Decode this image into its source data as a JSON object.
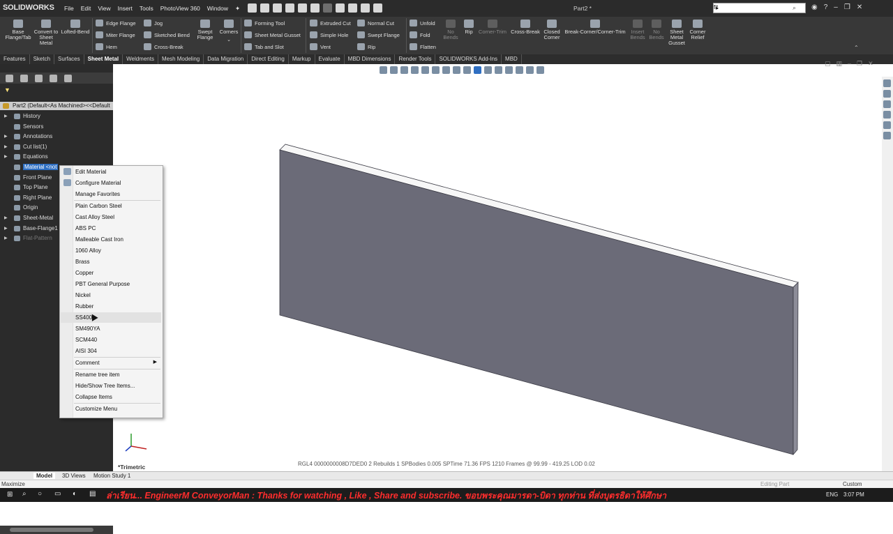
{
  "app": {
    "logo": "SOLIDWORKS",
    "menu": [
      "File",
      "Edit",
      "View",
      "Insert",
      "Tools",
      "PhotoView 360",
      "Window"
    ],
    "doc_title": "Part2 *",
    "search_value": "fit"
  },
  "ribbon": {
    "big_left": [
      {
        "label": "Base Flange/Tab",
        "icon": "base-flange-icon"
      },
      {
        "label": "Convert to Sheet Metal",
        "icon": "convert-icon"
      },
      {
        "label": "Lofted-Bend",
        "icon": "lofted-bend-icon"
      }
    ],
    "col1": [
      "Edge Flange",
      "Miter Flange",
      "Hem"
    ],
    "col2": [
      "Jog",
      "Sketched Bend",
      "Cross-Break"
    ],
    "swept_flange": "Swept Flange",
    "corners": "Corners",
    "col3": [
      "Forming Tool",
      "Sheet Metal Gusset",
      "Tab and Slot"
    ],
    "col4": [
      "Extruded Cut",
      "Simple Hole",
      "Vent"
    ],
    "col5": [
      "Normal Cut",
      "Swept Flange",
      "Rip"
    ],
    "col6": [
      "Unfold",
      "Fold",
      "Flatten"
    ],
    "big_right": [
      {
        "label": "No Bends",
        "dim": true
      },
      {
        "label": "Rip",
        "dim": false
      },
      {
        "label": "Corner-Trim",
        "dim": true
      },
      {
        "label": "Cross-Break",
        "dim": false
      },
      {
        "label": "Closed Corner",
        "dim": false
      },
      {
        "label": "Break-Corner/Corner-Trim",
        "dim": false
      },
      {
        "label": "Insert Bends",
        "dim": true
      },
      {
        "label": "No Bends",
        "dim": true
      },
      {
        "label": "Sheet Metal Gusset",
        "dim": false
      },
      {
        "label": "Corner Relief",
        "dim": false
      }
    ]
  },
  "tabs": [
    "Features",
    "Sketch",
    "Surfaces",
    "Sheet Metal",
    "Weldments",
    "Mesh Modeling",
    "Data Migration",
    "Direct Editing",
    "Markup",
    "Evaluate",
    "MBD Dimensions",
    "Render Tools",
    "SOLIDWORKS Add-Ins",
    "MBD"
  ],
  "active_tab": "Sheet Metal",
  "tree": {
    "part": "Part2  (Default<As Machined><<Default",
    "items": [
      {
        "label": "History",
        "arrow": true
      },
      {
        "label": "Sensors",
        "arrow": false
      },
      {
        "label": "Annotations",
        "arrow": true
      },
      {
        "label": "Cut list(1)",
        "arrow": true
      },
      {
        "label": "Equations",
        "arrow": true
      },
      {
        "label": "Material <not",
        "arrow": false,
        "selected": true
      },
      {
        "label": "Front Plane",
        "arrow": false
      },
      {
        "label": "Top Plane",
        "arrow": false
      },
      {
        "label": "Right Plane",
        "arrow": false
      },
      {
        "label": "Origin",
        "arrow": false
      },
      {
        "label": "Sheet-Metal",
        "arrow": true
      },
      {
        "label": "Base-Flange1",
        "arrow": true
      },
      {
        "label": "Flat-Pattern",
        "arrow": true,
        "dim": true
      }
    ]
  },
  "context_menu": {
    "top": [
      "Edit Material",
      "Configure Material",
      "Manage Favorites"
    ],
    "materials": [
      "Plain Carbon Steel",
      "Cast Alloy Steel",
      "ABS PC",
      "Malleable Cast Iron",
      "1060 Alloy",
      "Brass",
      "Copper",
      "PBT General Purpose",
      "Nickel",
      "Rubber",
      "SS400",
      "SM490YA",
      "SCM440",
      "AISI 304"
    ],
    "hovered": "SS400",
    "comment": "Comment",
    "bottom": [
      "Rename tree item",
      "Hide/Show Tree Items...",
      "Collapse Items"
    ],
    "customize": "Customize Menu"
  },
  "viewport": {
    "view_name": "*Trimetric",
    "status_info": "RGL4 0000000008D7DED0      2 Rebuilds      1 SPBodies  0.005 SPTime  71.36 FPS   1210 Frames @  99.99 - 419.25 LOD 0.02"
  },
  "bottom_tabs": [
    "Model",
    "3D Views",
    "Motion Study 1"
  ],
  "active_bottom_tab": "Model",
  "statusbar": {
    "left": "Maximize",
    "middle": "Editing Part",
    "right": "Custom"
  },
  "taskbar": {
    "ticker": "ล่าเรียน... EngineerM ConveyorMan : Thanks for watching , Like , Share and subscribe. ขอบพระคุณมารดา-บิดา ทุกท่าน ที่ส่งบุตรธิดาให้ศึกษา",
    "lang": "ENG",
    "time": "3:07 PM"
  },
  "colors": {
    "accent": "#2f6fc2",
    "part_face": "#6b6b78",
    "part_edge": "#3a3a44"
  }
}
